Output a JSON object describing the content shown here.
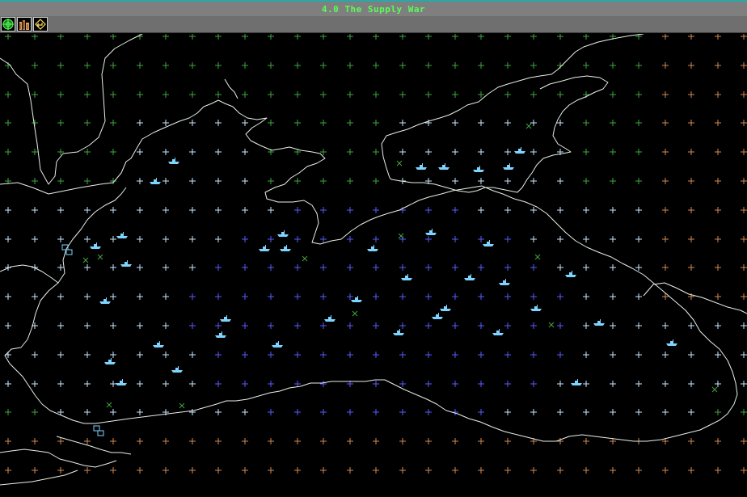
{
  "window": {
    "title": "4.0 The Supply War"
  },
  "toolbar": {
    "buttons": [
      {
        "name": "target-button",
        "icon": "crosshair-icon"
      },
      {
        "name": "buildings-button",
        "icon": "buildings-icon"
      },
      {
        "name": "return-button",
        "icon": "arrow-return-icon"
      }
    ]
  },
  "map": {
    "colors": {
      "background": "#000000",
      "coastline": "#e8f0e8",
      "grid_land_north": "#3fa63f",
      "grid_sea_near": "#c8e8ff",
      "grid_sea_deep": "#5a5aff",
      "grid_land_south": "#d08a55",
      "ship": "#7fd4ff",
      "port": "#7fd4ff",
      "wreck_marker": "#3fa63f"
    },
    "ship_count": 38,
    "port_count": 2,
    "wreck_marker_count": 12
  }
}
